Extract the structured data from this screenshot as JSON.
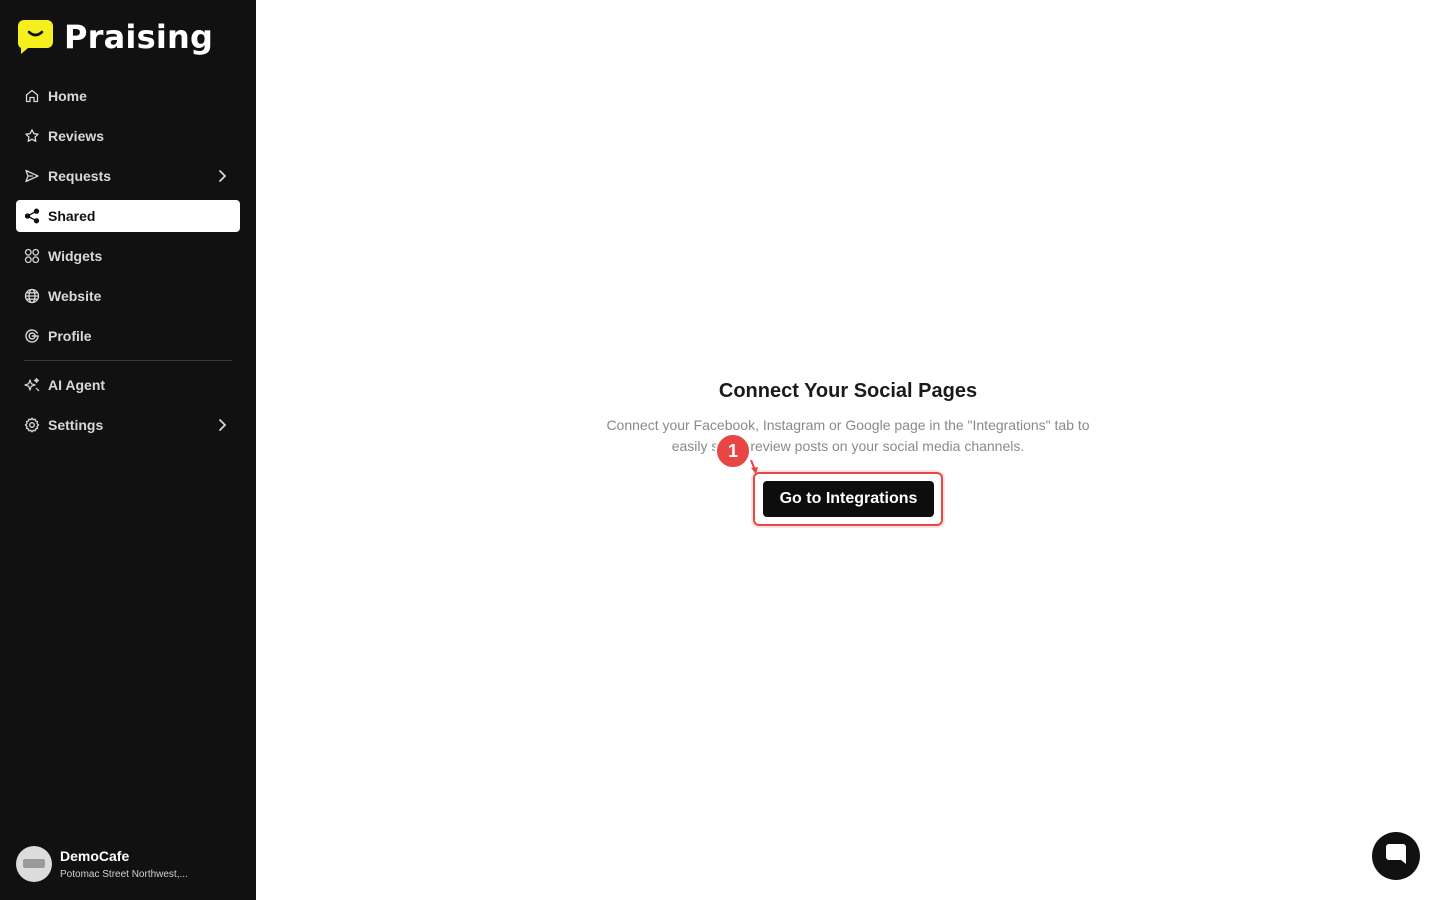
{
  "brand": {
    "name": "Praising",
    "accent": "#f5ef1d"
  },
  "sidebar": {
    "items": [
      {
        "label": "Home",
        "icon": "home-icon"
      },
      {
        "label": "Reviews",
        "icon": "star-icon"
      },
      {
        "label": "Requests",
        "icon": "send-icon",
        "has_submenu": true
      },
      {
        "label": "Shared",
        "icon": "share-icon",
        "active": true
      },
      {
        "label": "Widgets",
        "icon": "widgets-icon"
      },
      {
        "label": "Website",
        "icon": "globe-icon"
      },
      {
        "label": "Profile",
        "icon": "google-icon"
      },
      {
        "label": "AI Agent",
        "icon": "sparkle-icon"
      },
      {
        "label": "Settings",
        "icon": "gear-icon",
        "has_submenu": true
      }
    ]
  },
  "account": {
    "name": "DemoCafe",
    "address": "Potomac Street Northwest,..."
  },
  "main": {
    "title": "Connect Your Social Pages",
    "description": "Connect your Facebook, Instagram or Google page in the \"Integrations\" tab to easily share review posts on your social media channels.",
    "cta_label": "Go to Integrations"
  },
  "annotation": {
    "step": "1",
    "color": "#e84545"
  },
  "chat": {
    "icon": "chat-icon"
  }
}
